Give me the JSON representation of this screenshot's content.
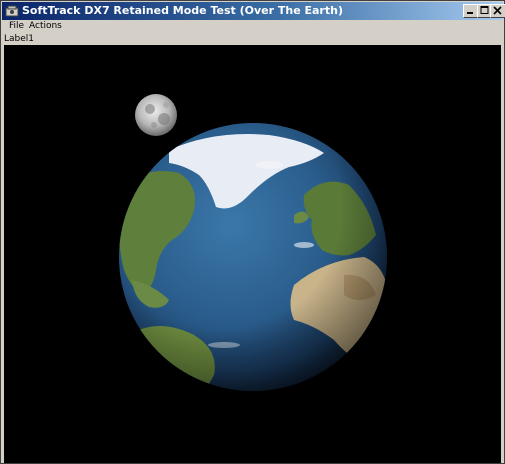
{
  "window": {
    "title": "SoftTrack DX7 Retained Mode Test (Over The Earth)"
  },
  "menu": {
    "items": [
      {
        "label": "File"
      },
      {
        "label": "Actions"
      }
    ]
  },
  "status": {
    "label": "Label1"
  },
  "colors": {
    "titlebar_start": "#0a246a",
    "titlebar_end": "#a6caf0",
    "chrome": "#d4d0c8",
    "viewport_bg": "#000000",
    "ocean": "#2a5d8c",
    "land": "#5a7a3a",
    "ice": "#e8ecf4",
    "moon": "#c8c8c8"
  }
}
